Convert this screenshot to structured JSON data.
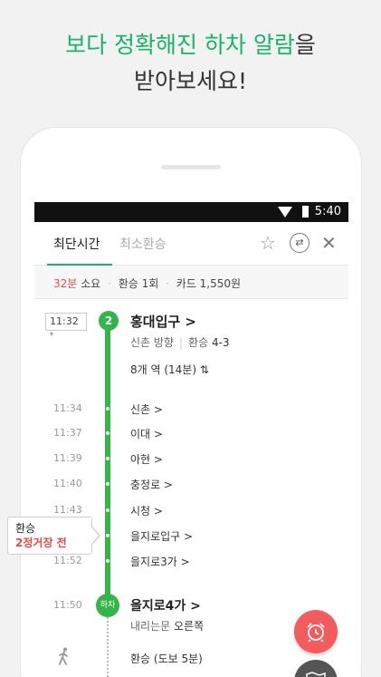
{
  "headline": {
    "line1_green": "보다 정확해진 하차 알람",
    "line1_rest": "을",
    "line2": "받아보세요!"
  },
  "statusbar": {
    "time": "5:40"
  },
  "tabs": [
    {
      "label": "최단시간",
      "active": true
    },
    {
      "label": "최소환승",
      "active": false
    }
  ],
  "summary": {
    "duration": "32분",
    "duration_suffix": "소요",
    "transfers": "환승 1회",
    "fare": "카드 1,550원"
  },
  "route": {
    "line_color": "#33b54a",
    "start": {
      "time": "11:32",
      "line_number": "2",
      "station": "홍대입구 >",
      "direction": "신촌 방향",
      "transfer_label": "환승",
      "transfer_door": "4-3",
      "stops_summary": "8개 역 (14분) ⇅"
    },
    "stops": [
      {
        "time": "11:34",
        "name": "신촌 >"
      },
      {
        "time": "11:37",
        "name": "이대 >"
      },
      {
        "time": "11:39",
        "name": "아현 >"
      },
      {
        "time": "11:40",
        "name": "충정로 >"
      },
      {
        "time": "11:43",
        "name": "시청 >"
      },
      {
        "time": "",
        "name": "을지로입구 >"
      },
      {
        "time": "11:52",
        "name": "을지로3가 >"
      }
    ],
    "end": {
      "badge": "하차",
      "time": "11:50",
      "station": "을지로4가 >",
      "door_label": "내리는문",
      "door_side": "오른쪽"
    },
    "walk": {
      "text": "환승 (도보 5분)",
      "icon": "walk-icon"
    }
  },
  "tooltip": {
    "line1": "환승",
    "line2_red": "2",
    "line2_rest": "정거장 전"
  },
  "fab": {
    "alarm_icon": "alarm-clock-icon",
    "alarm_color": "#f25c5c",
    "map_icon": "map-icon"
  }
}
